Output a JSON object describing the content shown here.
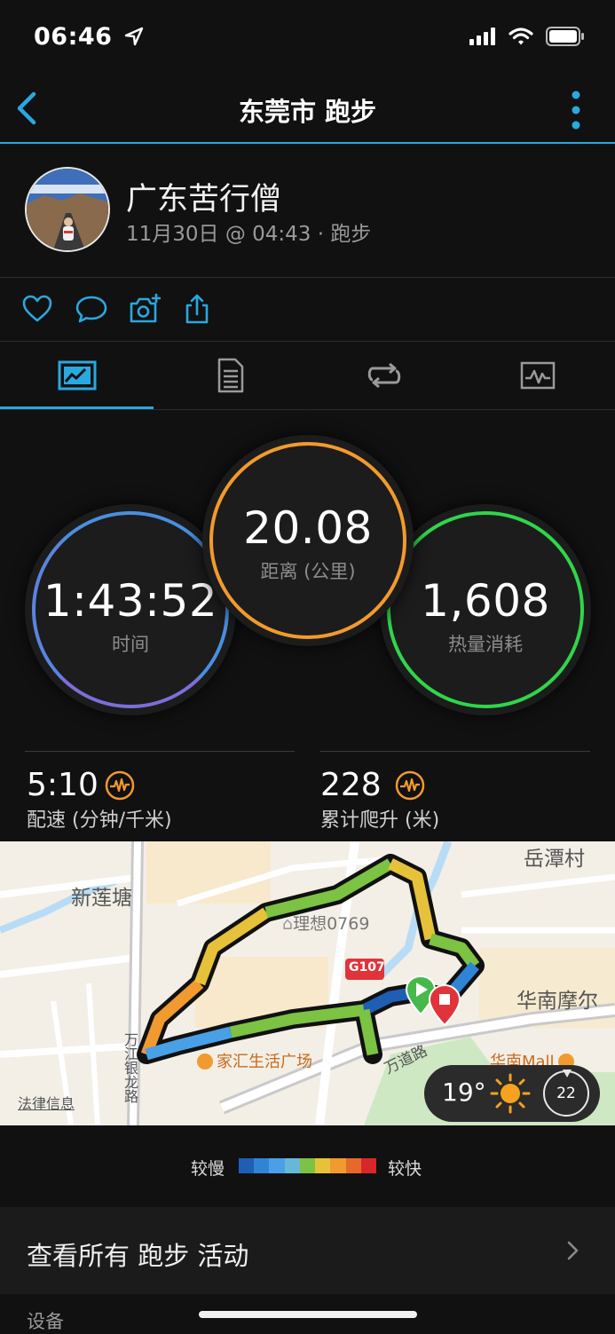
{
  "status_bar": {
    "time": "06:46"
  },
  "nav": {
    "title": "东莞市 跑步"
  },
  "profile": {
    "name": "广东苦行僧",
    "meta": "11月30日 @ 04:43 · 跑步"
  },
  "actions": [
    "heart-icon",
    "comment-icon",
    "camera-add-icon",
    "share-icon"
  ],
  "tabs": [
    {
      "name": "tab-summary",
      "icon": "summary-icon",
      "selected": true
    },
    {
      "name": "tab-details",
      "icon": "document-icon",
      "selected": false
    },
    {
      "name": "tab-laps",
      "icon": "laps-icon",
      "selected": false
    },
    {
      "name": "tab-charts",
      "icon": "chart-icon",
      "selected": false
    }
  ],
  "metrics": {
    "time": {
      "value": "1:43:52",
      "label": "时间"
    },
    "distance": {
      "value": "20.08",
      "label": "距离 (公里)"
    },
    "calories": {
      "value": "1,608",
      "label": "热量消耗"
    }
  },
  "stats": {
    "pace": {
      "value": "5:10",
      "label": "配速 (分钟/千米)"
    },
    "ascent": {
      "value": "228",
      "label": "累计爬升 (米)"
    }
  },
  "map": {
    "labels": {
      "yuetan": "岳潭村",
      "xinliantang": "新莲塘",
      "lixiang": "理想0769",
      "g107": "G107",
      "huanan": "华南摩尔",
      "jiahui": "家汇生活广场",
      "huanan_mall": "华南Mall",
      "wandao": "万道路",
      "wanjiang": "万江银龙路",
      "legal": "法律信息"
    },
    "weather": {
      "temp": "19°",
      "wind": "22"
    }
  },
  "legend": {
    "slow": "较慢",
    "fast": "较快",
    "colors": [
      "#1e5fb4",
      "#2f84d6",
      "#4aa0e6",
      "#67b8d8",
      "#7cc243",
      "#e6c23a",
      "#f09a30",
      "#e56a2a",
      "#d9262a"
    ]
  },
  "list": {
    "all_activities": "查看所有 跑步 活动",
    "devices": "设备"
  },
  "colors": {
    "accent": "#2aa8e0",
    "time_ring": "#4a8fe0",
    "distance_ring": "#f29a2e",
    "calories_ring": "#2fd64a"
  }
}
